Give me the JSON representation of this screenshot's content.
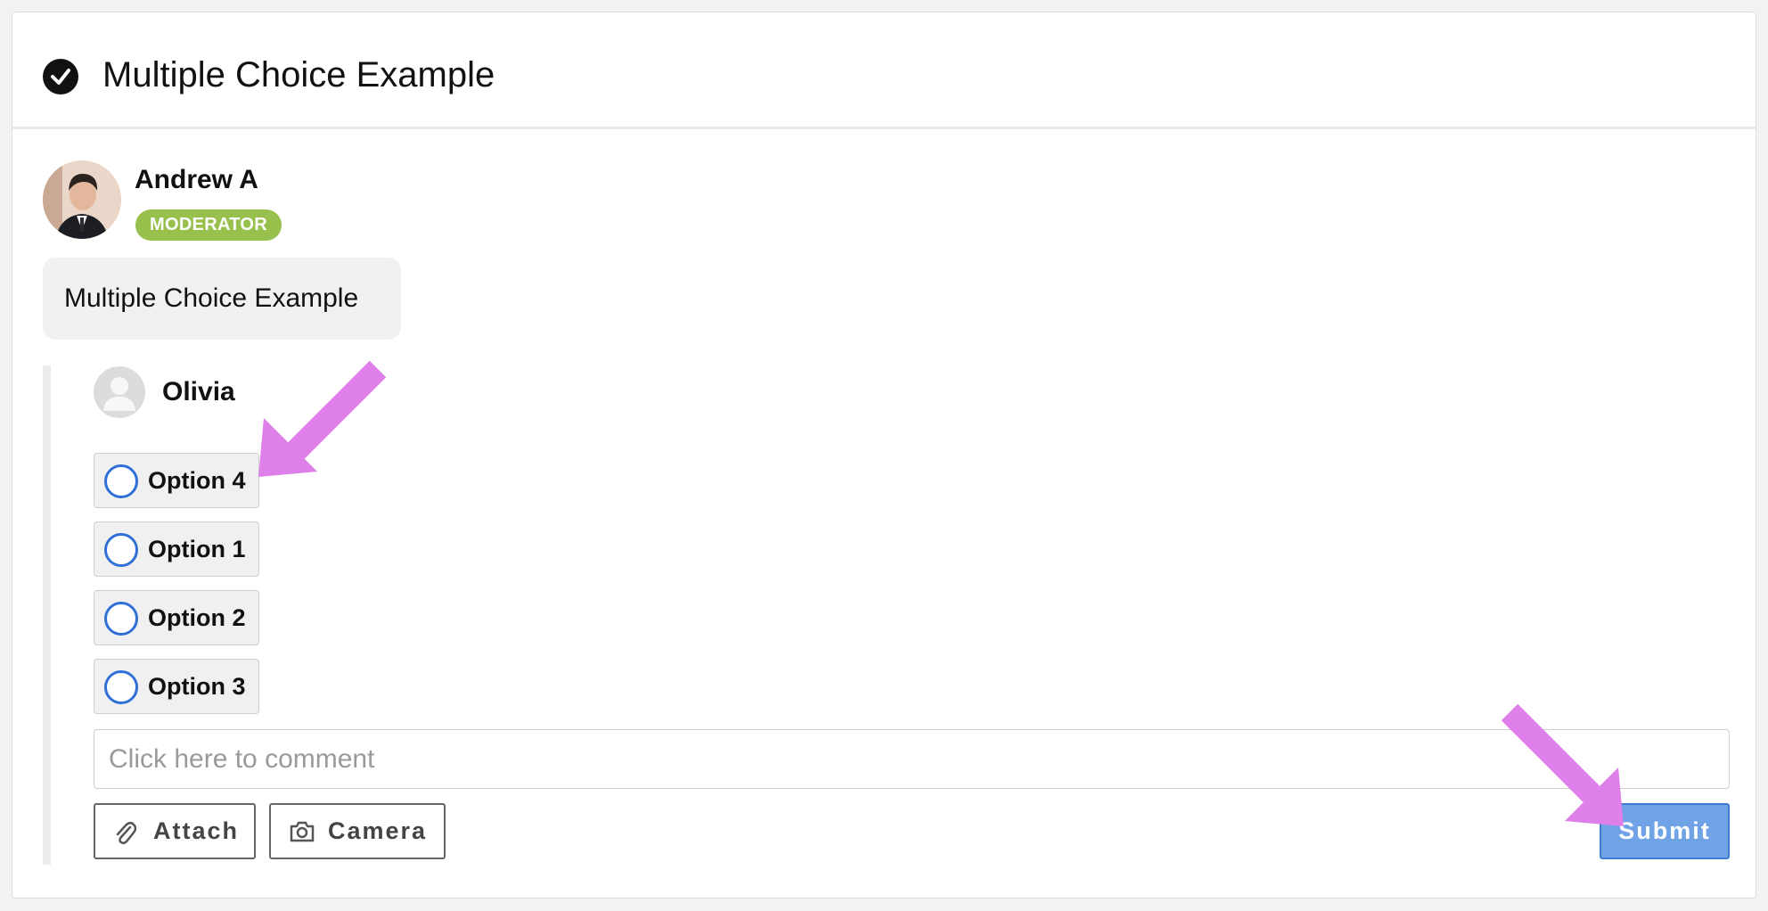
{
  "header": {
    "title": "Multiple Choice Example",
    "icon": "check-circle-icon"
  },
  "post": {
    "author": "Andrew A",
    "role_badge": "MODERATOR",
    "text": "Multiple Choice Example"
  },
  "reply": {
    "author": "Olivia",
    "options": [
      {
        "label": "Option 4",
        "selected": false
      },
      {
        "label": "Option 1",
        "selected": false
      },
      {
        "label": "Option 2",
        "selected": false
      },
      {
        "label": "Option 3",
        "selected": false
      }
    ]
  },
  "comment": {
    "placeholder": "Click here to comment",
    "value": ""
  },
  "actions": {
    "attach_label": "Attach",
    "camera_label": "Camera",
    "submit_label": "Submit"
  },
  "colors": {
    "accent": "#2f6fd6",
    "badge": "#97c04c",
    "submit": "#6fa3e6",
    "annotation_arrow": "#df7fe9"
  }
}
